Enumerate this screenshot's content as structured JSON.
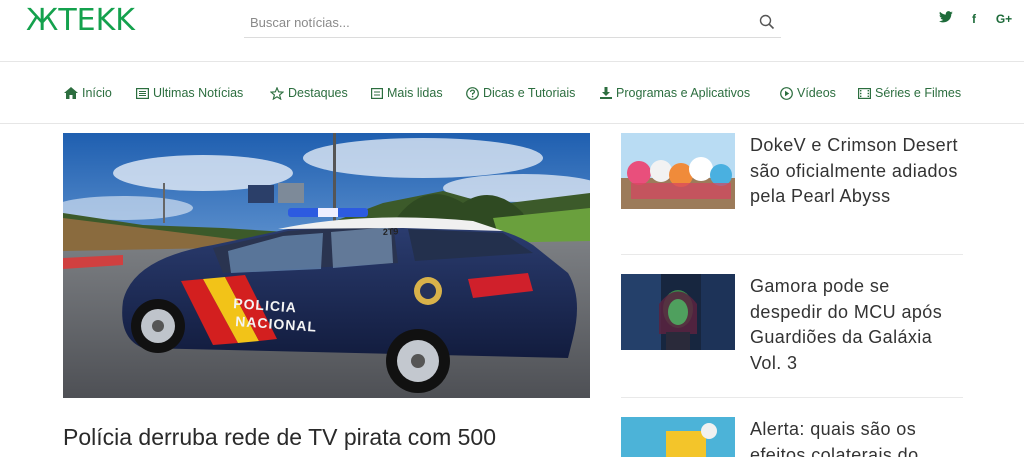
{
  "site": {
    "logo_text": "ЖTEKK",
    "brand_color": "#14a14d",
    "nav_color": "#2c6e3f"
  },
  "search": {
    "placeholder": "Buscar notícias...",
    "icon": "search-icon"
  },
  "social": [
    {
      "name": "twitter",
      "glyph": "🐦",
      "icon": "twitter-icon"
    },
    {
      "name": "facebook",
      "glyph": "f",
      "icon": "facebook-icon"
    },
    {
      "name": "google-plus",
      "glyph": "G+",
      "icon": "google-plus-icon"
    }
  ],
  "nav": [
    {
      "label": "Início",
      "icon": "home-icon"
    },
    {
      "label": "Ultimas Notícias",
      "icon": "newspaper-icon"
    },
    {
      "label": "Destaques",
      "icon": "star-icon"
    },
    {
      "label": "Mais lidas",
      "icon": "list-icon"
    },
    {
      "label": "Dicas e Tutoriais",
      "icon": "question-circle-icon"
    },
    {
      "label": "Programas e Aplicativos",
      "icon": "download-icon"
    },
    {
      "label": "Vídeos",
      "icon": "play-circle-icon"
    },
    {
      "label": "Séries e Filmes",
      "icon": "film-icon"
    }
  ],
  "hero": {
    "image_text": {
      "car_number": "2T9",
      "side_text_1": "POLICIA",
      "side_text_2": "NACIONAL"
    },
    "title": "Polícia derruba rede de TV pirata com 500"
  },
  "sidebar": [
    {
      "title": "DokeV e Crimson Desert são oficialmente adiados pela Pearl Abyss"
    },
    {
      "title": "Gamora pode se despedir do MCU após Guardiões da Galáxia Vol. 3"
    },
    {
      "title": "Alerta: quais são os efeitos colaterais do"
    }
  ]
}
